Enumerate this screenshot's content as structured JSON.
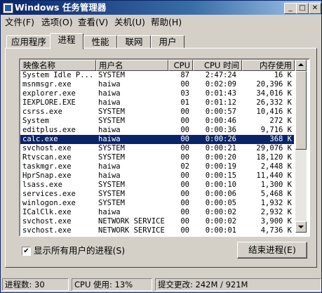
{
  "window": {
    "title": "Windows 任务管理器",
    "controls": {
      "minimize": "_",
      "maximize": "□",
      "close": "✕"
    }
  },
  "menu": [
    {
      "label": "文件(F)"
    },
    {
      "label": "选项(O)"
    },
    {
      "label": "查看(V)"
    },
    {
      "label": "关机(U)"
    },
    {
      "label": "帮助(H)"
    }
  ],
  "tabs": [
    {
      "label": "应用程序"
    },
    {
      "label": "进程",
      "active": true
    },
    {
      "label": "性能"
    },
    {
      "label": "联网"
    },
    {
      "label": "用户"
    }
  ],
  "columns": {
    "image": "映像名称",
    "user": "用户名",
    "cpu": "CPU",
    "cpu_time": "CPU 时间",
    "mem": "内存使用"
  },
  "processes": [
    {
      "name": "System Idle P...",
      "user": "SYSTEM",
      "cpu": "87",
      "time": "2:47:24",
      "mem": "16 K"
    },
    {
      "name": "msnmsgr.exe",
      "user": "haiwa",
      "cpu": "00",
      "time": "0:02:09",
      "mem": "20,396 K"
    },
    {
      "name": "explorer.exe",
      "user": "haiwa",
      "cpu": "03",
      "time": "0:01:43",
      "mem": "34,016 K"
    },
    {
      "name": "IEXPLORE.EXE",
      "user": "haiwa",
      "cpu": "01",
      "time": "0:01:12",
      "mem": "26,332 K"
    },
    {
      "name": "csrss.exe",
      "user": "SYSTEM",
      "cpu": "00",
      "time": "0:00:57",
      "mem": "10,416 K"
    },
    {
      "name": "System",
      "user": "SYSTEM",
      "cpu": "00",
      "time": "0:00:46",
      "mem": "272 K"
    },
    {
      "name": "editplus.exe",
      "user": "haiwa",
      "cpu": "00",
      "time": "0:00:36",
      "mem": "9,716 K"
    },
    {
      "name": "calc.exe",
      "user": "haiwa",
      "cpu": "00",
      "time": "0:00:26",
      "mem": "368 K",
      "selected": true
    },
    {
      "name": "svchost.exe",
      "user": "SYSTEM",
      "cpu": "00",
      "time": "0:00:21",
      "mem": "29,076 K"
    },
    {
      "name": "Rtvscan.exe",
      "user": "SYSTEM",
      "cpu": "00",
      "time": "0:00:20",
      "mem": "18,120 K"
    },
    {
      "name": "taskmgr.exe",
      "user": "haiwa",
      "cpu": "02",
      "time": "0:00:19",
      "mem": "2,448 K"
    },
    {
      "name": "HprSnap.exe",
      "user": "haiwa",
      "cpu": "00",
      "time": "0:00:15",
      "mem": "11,440 K"
    },
    {
      "name": "lsass.exe",
      "user": "SYSTEM",
      "cpu": "00",
      "time": "0:00:10",
      "mem": "1,300 K"
    },
    {
      "name": "services.exe",
      "user": "SYSTEM",
      "cpu": "00",
      "time": "0:00:06",
      "mem": "5,468 K"
    },
    {
      "name": "winlogon.exe",
      "user": "SYSTEM",
      "cpu": "00",
      "time": "0:00:05",
      "mem": "1,932 K"
    },
    {
      "name": "ICalClk.exe",
      "user": "haiwa",
      "cpu": "00",
      "time": "0:00:02",
      "mem": "2,932 K"
    },
    {
      "name": "svchost.exe",
      "user": "NETWORK SERVICE",
      "cpu": "00",
      "time": "0:00:02",
      "mem": "3,900 K"
    },
    {
      "name": "svchost.exe",
      "user": "NETWORK SERVICE",
      "cpu": "00",
      "time": "0:00:01",
      "mem": "4,736 K"
    }
  ],
  "show_all_users": {
    "label": "显示所有用户的进程(S)",
    "checked": true,
    "check_glyph": "✔"
  },
  "end_process_label": "结束进程(E)",
  "status": {
    "processes": "进程数: 30",
    "cpu": "CPU 使用: 13%",
    "commit": "提交更改: 242M / 921M"
  },
  "colors": {
    "selection": "#0a246a",
    "face": "#d4d0c8",
    "title_start": "#0a246a"
  }
}
